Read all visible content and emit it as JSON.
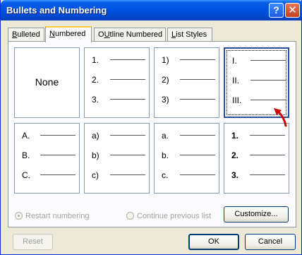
{
  "window": {
    "title": "Bullets and Numbering"
  },
  "titlebar": {
    "help_glyph": "?",
    "close_glyph": "✕"
  },
  "tabs": [
    {
      "label": "Bulleted",
      "underline": "B",
      "rest": "ulleted"
    },
    {
      "label": "Numbered",
      "underline": "N",
      "rest": "umbered"
    },
    {
      "label": "Outline Numbered",
      "underline": "U",
      "rest": "tline Numbered",
      "prefix": "O"
    },
    {
      "label": "List Styles",
      "underline": "L",
      "rest": "ist Styles"
    }
  ],
  "styles": {
    "none_label": "None",
    "arabic_period": [
      "1.",
      "2.",
      "3."
    ],
    "arabic_paren": [
      "1)",
      "2)",
      "3)"
    ],
    "roman_upper": [
      "I.",
      "II.",
      "III."
    ],
    "alpha_upper": [
      "A.",
      "B.",
      "C."
    ],
    "alpha_lower_paren": [
      "a)",
      "b)",
      "c)"
    ],
    "alpha_lower_period": [
      "a.",
      "b.",
      "c."
    ],
    "arabic_bold": [
      "1.",
      "2.",
      "3."
    ]
  },
  "selected_style": "roman_upper",
  "options": {
    "restart": "Restart numbering",
    "continue": "Continue previous list"
  },
  "buttons": {
    "customize": "Customize...",
    "reset": "Reset",
    "ok": "OK",
    "cancel": "Cancel"
  },
  "colors": {
    "titlebar": "#0055E5",
    "selection_border": "#2A4E9A",
    "annotation_arrow": "#D00000"
  }
}
